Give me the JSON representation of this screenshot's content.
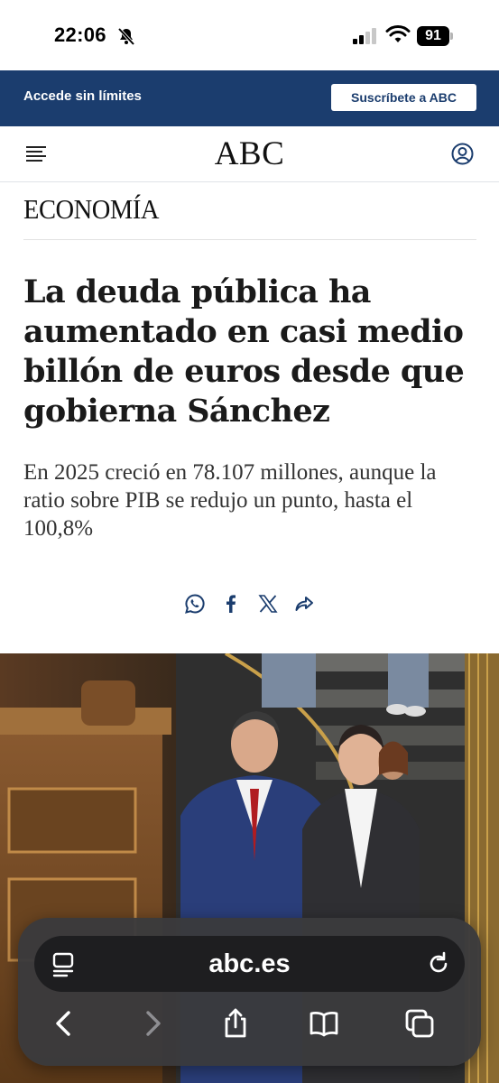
{
  "status_bar": {
    "time": "22:06",
    "battery": "91"
  },
  "subscribe": {
    "text": "Accede sin límites",
    "button": "Suscríbete a ABC"
  },
  "header": {
    "logo": "ABC"
  },
  "article": {
    "section": "ECONOMÍA",
    "headline": "La deuda pública ha aumentado en casi medio billón de euros desde que gobierna Sánchez",
    "subheadline": "En 2025 creció en 78.107 millones, aunque la ratio sobre PIB se redujo un punto, hasta el 100,8%"
  },
  "share": [
    "whatsapp-icon",
    "facebook-icon",
    "x-icon",
    "share-icon"
  ],
  "colors": {
    "brand_blue": "#1b3d6e",
    "icon_blue": "#1b3d6e",
    "toolbar": "#3a3a3c"
  },
  "browser": {
    "url": "abc.es"
  }
}
